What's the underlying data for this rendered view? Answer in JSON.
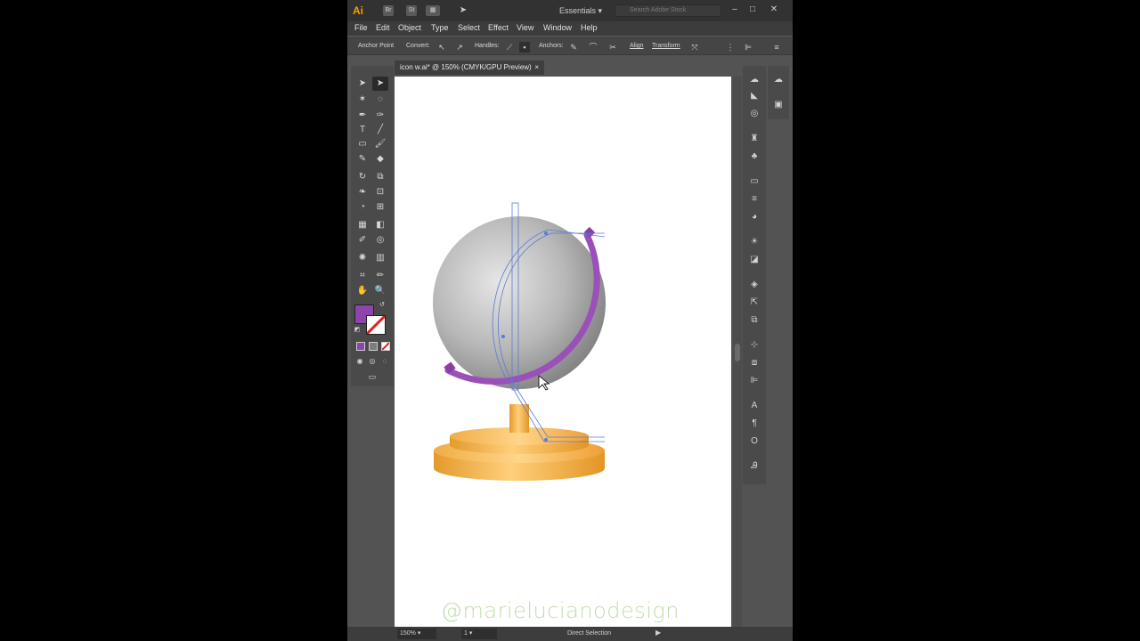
{
  "app": {
    "logo": "Ai",
    "workspace": "Essentials",
    "search_placeholder": "Search Adobe Stock",
    "menus": [
      "File",
      "Edit",
      "Object",
      "Type",
      "Select",
      "Effect",
      "View",
      "Window",
      "Help"
    ]
  },
  "controlbar": {
    "anchor_point": "Anchor Point",
    "convert": "Convert:",
    "handles": "Handles:",
    "anchors": "Anchors:",
    "align": "Align",
    "transform": "Transform"
  },
  "document": {
    "tab_title": "icon w.ai* @ 150% (CMYK/GPU Preview)",
    "close": "×"
  },
  "status": {
    "zoom": "150%",
    "page": "1",
    "tool": "Direct Selection"
  },
  "watermark": "@marielucianodesign",
  "colors": {
    "fill": "#8e44ad",
    "globe_stand": "#9b4fb8",
    "base": "#f0a83a",
    "accent": "#ff9a00"
  },
  "icons": {
    "selection": "arrow-icon",
    "direct_selection": "direct-arrow-icon"
  }
}
